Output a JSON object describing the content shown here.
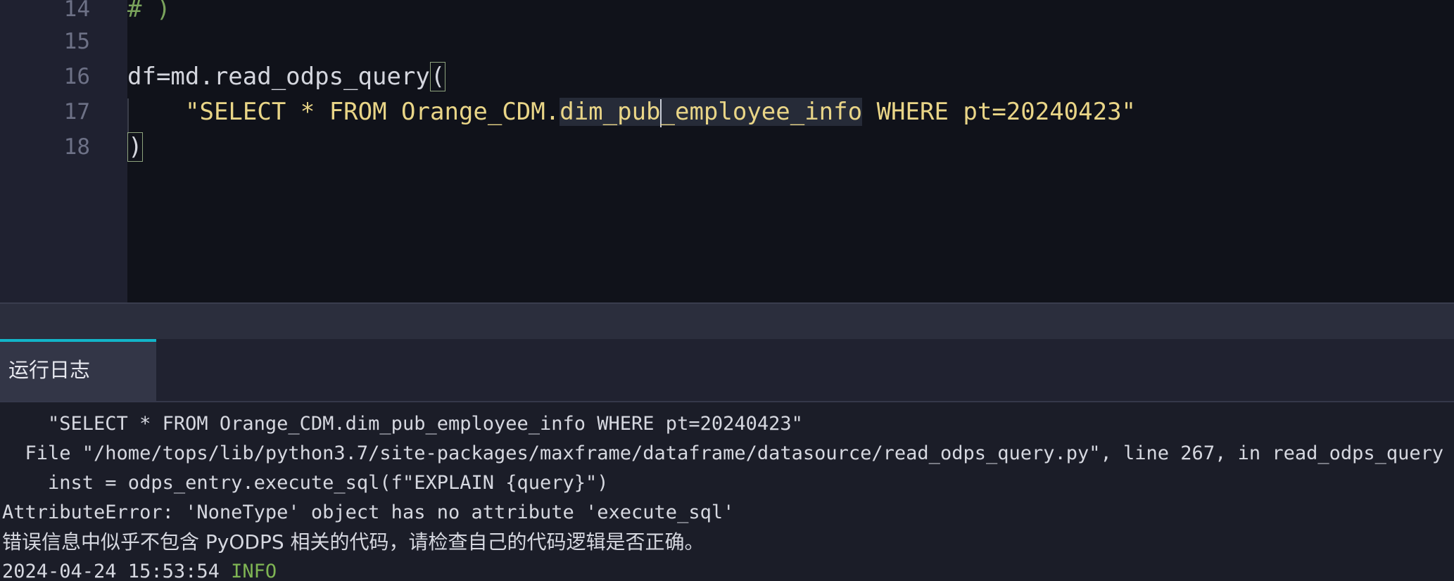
{
  "editor": {
    "line_numbers": [
      "14",
      "15",
      "16",
      "17",
      "18"
    ],
    "line14": "# )",
    "line16": {
      "prefix": "df=md.read_odps_query",
      "paren_open": "("
    },
    "line17": {
      "string_before": "\"SELECT * FROM Orange_CDM.",
      "selected_a": "dim_pub",
      "selected_b": "_employee_info",
      "string_after": " WHERE pt=20240423\""
    },
    "line18": {
      "paren_close": ")"
    }
  },
  "panel": {
    "tab_label": "运行日志"
  },
  "log": {
    "line1": "    \"SELECT * FROM Orange_CDM.dim_pub_employee_info WHERE pt=20240423\"",
    "line2": "  File \"/home/tops/lib/python3.7/site-packages/maxframe/dataframe/datasource/read_odps_query.py\", line 267, in read_odps_query",
    "line3": "    inst = odps_entry.execute_sql(f\"EXPLAIN {query}\")",
    "line4": "AttributeError: 'NoneType' object has no attribute 'execute_sql'",
    "line5": "错误信息中似乎不包含 PyODPS 相关的代码，请检查自己的代码逻辑是否正确。",
    "line6_time": "2024-04-24 15:53:54",
    "line6_level": "INFO"
  },
  "colors": {
    "editor_bg": "#10121a",
    "gutter_bg": "#1f2130",
    "string": "#e9d587",
    "comment": "#7aa35c",
    "tab_accent": "#12b5c9",
    "info_level": "#7fb554"
  }
}
